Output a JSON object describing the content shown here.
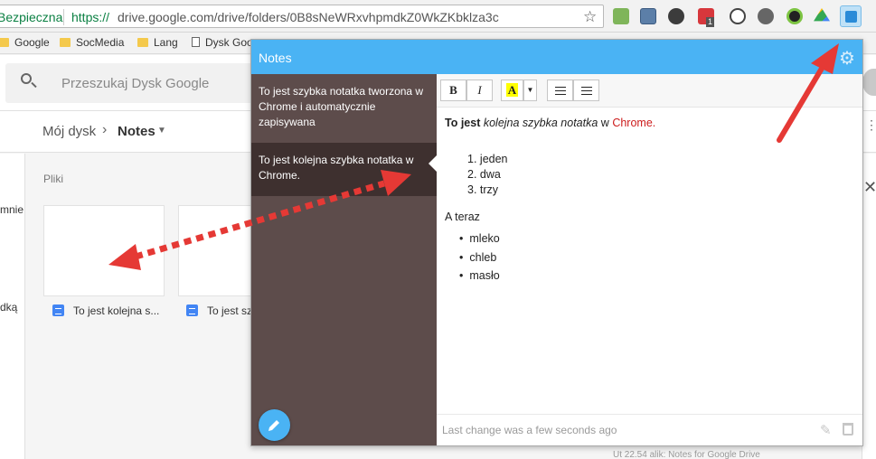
{
  "browser": {
    "secure_label": "Bezpieczna",
    "url_protocol": "https://",
    "url_rest": "drive.google.com/drive/folders/0B8sNeWRxvhpmdkZ0WkZKbklza3c",
    "star_icon": "☆",
    "ext_badge": "1"
  },
  "bookmarks": [
    {
      "label": "Google",
      "icon": "folder-icon"
    },
    {
      "label": "SocMedia",
      "icon": "folder-icon"
    },
    {
      "label": "Lang",
      "icon": "folder-icon"
    },
    {
      "label": "Dysk Goo",
      "icon": "page-icon"
    }
  ],
  "drive": {
    "search_placeholder": "Przeszukaj Dysk Google",
    "breadcrumb_root": "Mój dysk",
    "breadcrumb_sep": "›",
    "breadcrumb_current": "Notes",
    "files_label": "Pliki",
    "rail_text_1": "mnie",
    "rail_text_2": "dką",
    "files": [
      {
        "name": "To jest kolejna s..."
      },
      {
        "name": "To jest sz"
      }
    ],
    "bottom_text": "Ut                       22.54       alik: Notes for Google Drive"
  },
  "popup": {
    "title": "Notes",
    "notes": [
      {
        "text": "To jest szybka notatka tworzona w Chrome i automatycznie zapisywana"
      },
      {
        "text": "To jest kolejna szybka notatka w Chrome."
      }
    ],
    "toolbar": {
      "bold": "B",
      "italic": "I",
      "color": "A",
      "dropdown": "▼"
    },
    "note": {
      "line1_bold": "To jest",
      "line1_italic": "kolejna szybka notatka",
      "line1_mid": "w",
      "line1_red": "Chrome",
      "line1_end": ".",
      "ordered": [
        "jeden",
        "dwa",
        "trzy"
      ],
      "ordered_markers": [
        "1.",
        "2.",
        "3."
      ],
      "after_list": "A teraz",
      "bullets": [
        "mleko",
        "chleb",
        "masło"
      ]
    },
    "footer": "Last change was a few seconds ago"
  },
  "colors": {
    "header_blue": "#4ab3f4",
    "notes_list_bg": "#5d4c4b",
    "notes_active_bg": "#3e302f",
    "arrow_red": "#e53935"
  }
}
